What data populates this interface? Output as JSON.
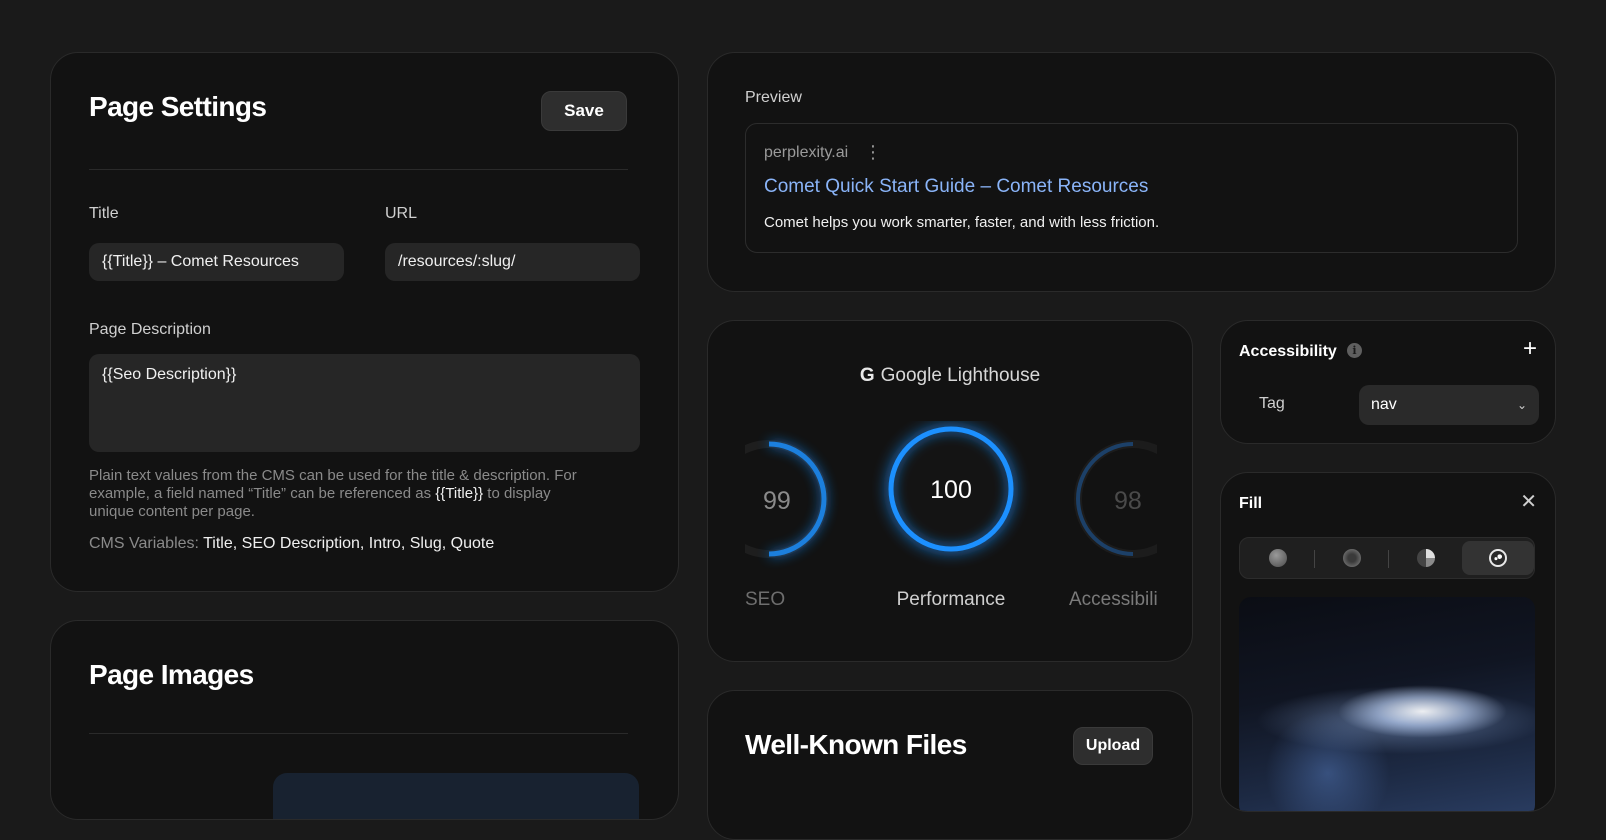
{
  "page_settings": {
    "heading": "Page Settings",
    "save_label": "Save",
    "title_label": "Title",
    "title_value": "{{Title}} – Comet Resources",
    "url_label": "URL",
    "url_value": "/resources/:slug/",
    "description_label": "Page Description",
    "description_value": "{{Seo Description}}",
    "help_line1": "Plain text values from the CMS can be used for the title & description. For",
    "help_line2_a": "example, a field named “Title” can be referenced as ",
    "help_line2_b": "{{Title}}",
    "help_line2_c": " to display",
    "help_line3": "unique content per page.",
    "vars_label": "CMS Variables: ",
    "vars_value": "Title, SEO Description, Intro, Slug, Quote"
  },
  "page_images": {
    "heading": "Page Images"
  },
  "preview": {
    "label": "Preview",
    "domain": "perplexity.ai",
    "menu_glyph": "⋮",
    "title": "Comet Quick Start Guide – Comet Resources",
    "description": "Comet helps you work smarter, faster, and with less friction."
  },
  "lighthouse": {
    "g_glyph": "G",
    "title": "Google Lighthouse",
    "scores": [
      {
        "label": "SEO",
        "value": 99
      },
      {
        "label": "Performance",
        "value": 100
      },
      {
        "label": "Accessibility",
        "value": 98
      }
    ]
  },
  "accessibility": {
    "heading": "Accessibility",
    "info_glyph": "i",
    "add_glyph": "+",
    "tag_label": "Tag",
    "tag_value": "nav",
    "chevron_glyph": "⌄"
  },
  "fill": {
    "heading": "Fill",
    "close_glyph": "✕",
    "selected_option": 4
  },
  "well_known": {
    "heading": "Well-Known Files",
    "upload_label": "Upload"
  },
  "colors": {
    "accent_blue": "#1e90ff",
    "link_blue": "#8ab4f8",
    "background": "#1a1a1a",
    "card": "#121212"
  }
}
